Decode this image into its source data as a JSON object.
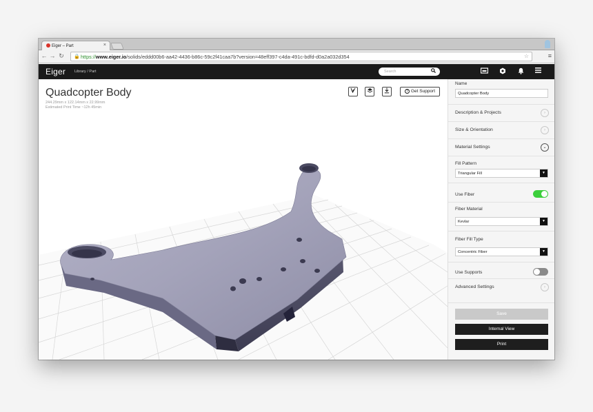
{
  "browser": {
    "tab_title": "Eiger – Part",
    "tab_close": "×",
    "url_scheme": "https://",
    "url_host": "www.eiger.io",
    "url_path": "/solids/eddd00b6-aa42-4436-b86c-59c2f41caa7b?version=48eff397-c4da-491c-bdfd-d0a2a032d354"
  },
  "header": {
    "logo": "Eiger",
    "breadcrumb": "Library / Part",
    "search_placeholder": "Search"
  },
  "part": {
    "title": "Quadcopter Body",
    "dimensions": "244.29mm x 122.14mm x 22.99mm",
    "print_time": "Estimated Print Time ~12h 45min",
    "support_label": "Get Support"
  },
  "panel": {
    "name_label": "Name",
    "name_value": "Quadcopter Body",
    "sections": {
      "description": "Description & Projects",
      "size": "Size & Orientation",
      "material": "Material Settings",
      "advanced": "Advanced Settings"
    },
    "fill_pattern_label": "Fill Pattern",
    "fill_pattern_value": "Triangular Fill",
    "use_fiber_label": "Use Fiber",
    "use_fiber_on": true,
    "fiber_material_label": "Fiber Material",
    "fiber_material_value": "Kevlar",
    "fiber_fill_type_label": "Fiber Fill Type",
    "fiber_fill_type_value": "Concentric Fiber",
    "use_supports_label": "Use Supports",
    "use_supports_on": false,
    "save_label": "Save",
    "internal_view_label": "Internal View",
    "print_label": "Print"
  },
  "colors": {
    "toggle_on": "#3ccf3c",
    "toggle_off": "#8a8a8a",
    "header_bg": "#1a1a1a",
    "model": "#8a89a3"
  }
}
